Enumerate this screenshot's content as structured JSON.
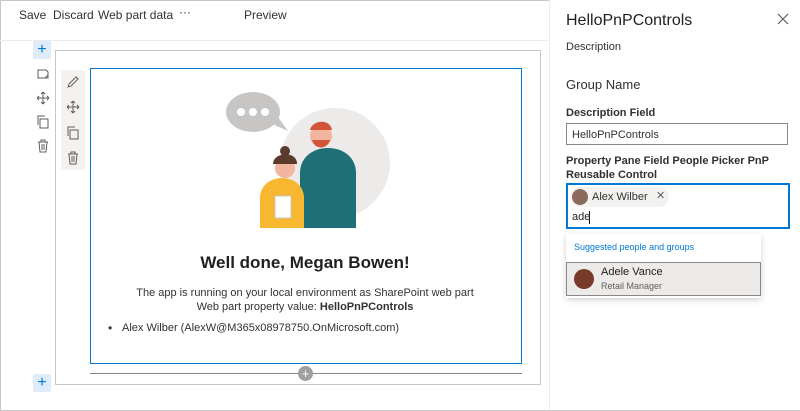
{
  "toolbar": {
    "save": "Save",
    "discard": "Discard",
    "web_part_data": "Web part data",
    "more": "···",
    "preview": "Preview"
  },
  "canvas": {
    "add_section_symbol": "+",
    "webpart": {
      "heading": "Well done, Megan Bowen!",
      "line1": "The app is running on your local environment as SharePoint web part",
      "line2_prefix": "Web part property value: ",
      "line2_value": "HelloPnPControls",
      "list_items": [
        "Alex Wilber (AlexW@M365x08978750.OnMicrosoft.com)"
      ]
    }
  },
  "panel": {
    "title": "HelloPnPControls",
    "description": "Description",
    "group_name": "Group Name",
    "description_field_label": "Description Field",
    "description_field_value": "HelloPnPControls",
    "people_picker_label_line1": "Property Pane Field People Picker PnP",
    "people_picker_label_line2": "Reusable Control",
    "selected_person": "Alex Wilber",
    "picker_input_value": "ade",
    "suggestions_header": "Suggested people and groups",
    "suggestion": {
      "name": "Adele Vance",
      "role": "Retail Manager"
    }
  },
  "colors": {
    "accent": "#0078d4",
    "accent_light": "#deecf9"
  },
  "icons": [
    "pencil-icon",
    "move-icon",
    "copy-icon",
    "trash-icon",
    "close-icon",
    "plus-icon",
    "note-icon"
  ]
}
